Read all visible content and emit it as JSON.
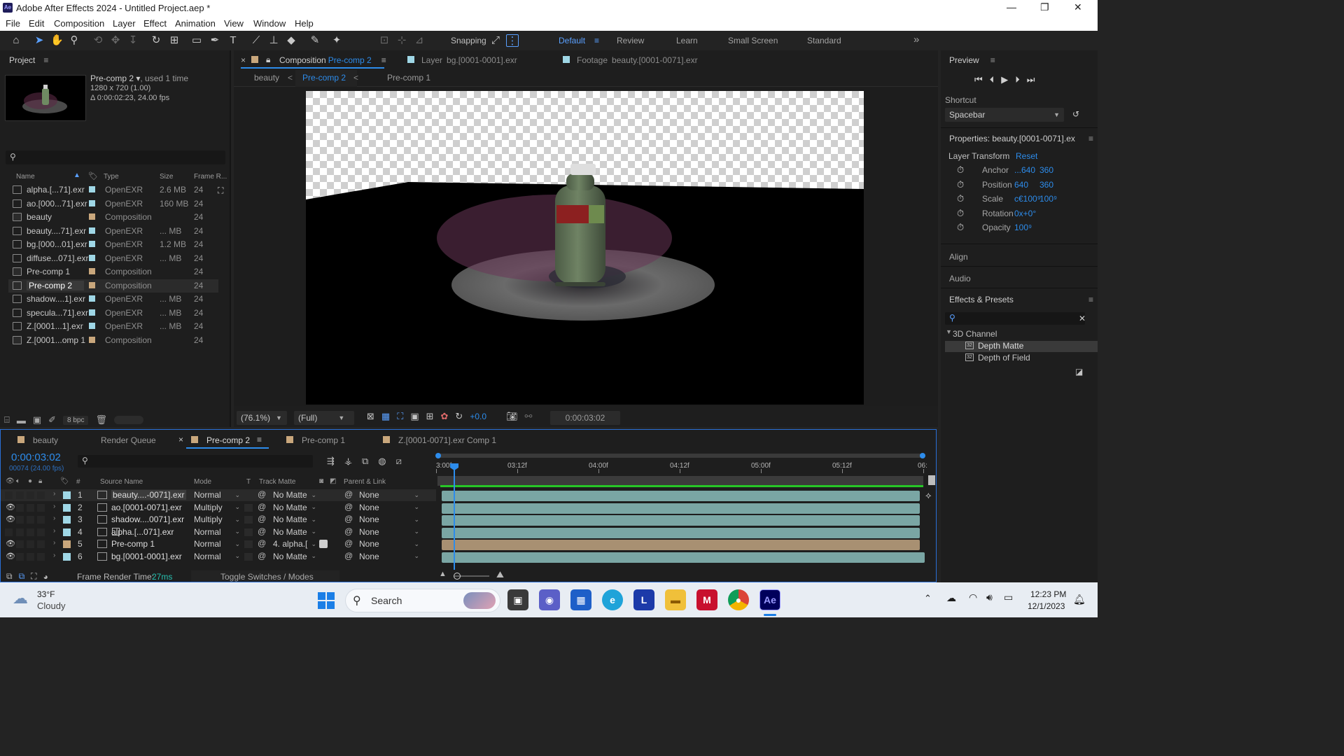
{
  "window": {
    "app_icon": "Ae",
    "title": "Adobe After Effects 2024 - Untitled Project.aep *",
    "controls": [
      "—",
      "❐",
      "✕"
    ]
  },
  "menu": [
    "File",
    "Edit",
    "Composition",
    "Layer",
    "Effect",
    "Animation",
    "View",
    "Window",
    "Help"
  ],
  "toolbar": {
    "snapping_label": "Snapping",
    "workspaces": [
      "Default",
      "Review",
      "Learn",
      "Small Screen",
      "Standard"
    ],
    "overflow": "»"
  },
  "project": {
    "title": "Project",
    "thumb": {
      "name": "Pre-comp 2 ▾",
      "used": ", used 1 time",
      "resolution": "1280 x 720 (1.00)",
      "duration": "Δ 0:00:02:23, 24.00 fps"
    },
    "columns": {
      "name": "Name",
      "type": "Type",
      "size": "Size",
      "frame_rate": "Frame R..."
    },
    "items": [
      {
        "name": "alpha.[...71].exr",
        "type": "OpenEXR",
        "size": "2.6 MB",
        "rate": "24",
        "label_color": "#9fd7e6",
        "kind": "footage"
      },
      {
        "name": "ao.[000...71].exr",
        "type": "OpenEXR",
        "size": "160 MB",
        "rate": "24",
        "label_color": "#9fd7e6",
        "kind": "footage"
      },
      {
        "name": "beauty",
        "type": "Composition",
        "size": "",
        "rate": "24",
        "label_color": "#c9a77c",
        "kind": "comp"
      },
      {
        "name": "beauty....71].exr",
        "type": "OpenEXR",
        "size": "... MB",
        "rate": "24",
        "label_color": "#9fd7e6",
        "kind": "footage"
      },
      {
        "name": "bg.[000...01].exr",
        "type": "OpenEXR",
        "size": "1.2 MB",
        "rate": "24",
        "label_color": "#9fd7e6",
        "kind": "footage"
      },
      {
        "name": "diffuse...071].exr",
        "type": "OpenEXR",
        "size": "... MB",
        "rate": "24",
        "label_color": "#9fd7e6",
        "kind": "footage"
      },
      {
        "name": "Pre-comp 1",
        "type": "Composition",
        "size": "",
        "rate": "24",
        "label_color": "#c9a77c",
        "kind": "comp"
      },
      {
        "name": "Pre-comp 2",
        "type": "Composition",
        "size": "",
        "rate": "24",
        "label_color": "#c9a77c",
        "kind": "comp"
      },
      {
        "name": "shadow....1].exr",
        "type": "OpenEXR",
        "size": "... MB",
        "rate": "24",
        "label_color": "#9fd7e6",
        "kind": "footage"
      },
      {
        "name": "specula...71].exr",
        "type": "OpenEXR",
        "size": "... MB",
        "rate": "24",
        "label_color": "#9fd7e6",
        "kind": "footage"
      },
      {
        "name": "Z.[0001...1].exr",
        "type": "OpenEXR",
        "size": "... MB",
        "rate": "24",
        "label_color": "#9fd7e6",
        "kind": "footage"
      },
      {
        "name": "Z.[0001...omp 1",
        "type": "Composition",
        "size": "",
        "rate": "24",
        "label_color": "#c9a77c",
        "kind": "comp"
      }
    ],
    "selected_index": 7,
    "bpc": "8 bpc"
  },
  "comp_panel": {
    "tabs": [
      {
        "prefix": "Composition",
        "name": "Pre-comp 2"
      },
      {
        "prefix": "Layer",
        "name": "bg.[0001-0001].exr"
      },
      {
        "prefix": "Footage",
        "name": "beauty.[0001-0071].exr"
      }
    ],
    "breadcrumbs": [
      "beauty",
      "Pre-comp 2",
      "Pre-comp 1"
    ],
    "zoom": "(76.1%)",
    "resolution": "(Full)",
    "exposure": "+0.0",
    "timecode": "0:00:03:02"
  },
  "right": {
    "preview": {
      "title": "Preview",
      "shortcut_label": "Shortcut",
      "shortcut_value": "Spacebar"
    },
    "properties": {
      "title": "Properties: beauty.[0001-0071].ex",
      "section": "Layer Transform",
      "reset": "Reset",
      "rows": [
        {
          "label": "Anchor",
          "v1": "...640",
          "v2": "360"
        },
        {
          "label": "Position",
          "v1": "640",
          "v2": "360"
        },
        {
          "label": "Scale",
          "v1": "c€100⁹",
          "v2": "100⁹"
        },
        {
          "label": "Rotation",
          "v1": "0x+0°",
          "v2": ""
        },
        {
          "label": "Opacity",
          "v1": "100⁹",
          "v2": ""
        }
      ]
    },
    "align": "Align",
    "audio": "Audio",
    "effects": {
      "title": "Effects & Presets",
      "category": "3D Channel",
      "items": [
        "Depth Matte",
        "Depth of Field"
      ],
      "selected": 0
    }
  },
  "timeline": {
    "tabs": [
      {
        "name": "beauty",
        "color": "#c9a77c"
      },
      {
        "name": "Render Queue",
        "color": ""
      },
      {
        "name": "Pre-comp 2",
        "color": "#c9a77c"
      },
      {
        "name": "Pre-comp 1",
        "color": "#c9a77c"
      },
      {
        "name": "Z.[0001-0071].exr Comp 1",
        "color": "#c9a77c"
      }
    ],
    "active_tab": 2,
    "timecode": "0:00:03:02",
    "frame_info": "00074 (24.00 fps)",
    "columns": {
      "source": "Source Name",
      "mode": "Mode",
      "t": "T",
      "track_matte": "Track Matte",
      "parent": "Parent & Link",
      "num": "#"
    },
    "ruler": [
      "3:00f",
      "03:12f",
      "04:00f",
      "04:12f",
      "05:00f",
      "05:12f",
      "06:"
    ],
    "layers": [
      {
        "num": "1",
        "name": "beauty....-0071].exr",
        "mode": "Normal",
        "matte": "No Matte",
        "parent": "None",
        "color": "#9fd7e6",
        "bar_color": "#7aa6a4",
        "eye": false,
        "selected": true
      },
      {
        "num": "2",
        "name": "ao.[0001-0071].exr",
        "mode": "Multiply",
        "matte": "No Matte",
        "parent": "None",
        "color": "#9fd7e6",
        "bar_color": "#7aa6a4",
        "eye": true,
        "selected": false
      },
      {
        "num": "3",
        "name": "shadow....0071].exr",
        "mode": "Multiply",
        "matte": "No Matte",
        "parent": "None",
        "color": "#9fd7e6",
        "bar_color": "#7aa6a4",
        "eye": true,
        "selected": false
      },
      {
        "num": "4",
        "name": "alpha.[...071].exr",
        "mode": "Normal",
        "matte": "No Matte",
        "parent": "None",
        "color": "#9fd7e6",
        "bar_color": "#7aa6a4",
        "eye": false,
        "selected": false
      },
      {
        "num": "5",
        "name": "Pre-comp 1",
        "mode": "Normal",
        "matte": "4. alpha.[",
        "parent": "None",
        "color": "#c9a77c",
        "bar_color": "#a89072",
        "eye": true,
        "selected": false
      },
      {
        "num": "6",
        "name": "bg.[0001-0001].exr",
        "mode": "Normal",
        "matte": "No Matte",
        "parent": "None",
        "color": "#9fd7e6",
        "bar_color": "#7aa6a4",
        "eye": true,
        "selected": false
      }
    ],
    "footer": {
      "render_label": "Frame Render Time:",
      "render_value": "27ms",
      "toggle": "Toggle Switches / Modes"
    }
  },
  "taskbar": {
    "weather_temp": "33°F",
    "weather_desc": "Cloudy",
    "search_placeholder": "Search",
    "time": "12:23 PM",
    "date": "12/1/2023"
  }
}
